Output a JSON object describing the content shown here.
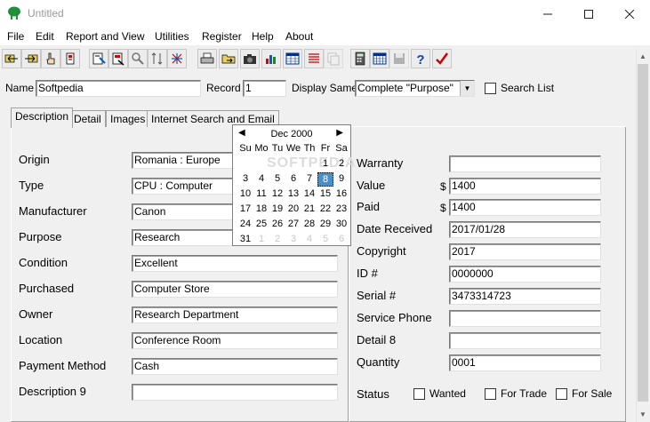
{
  "window": {
    "title": "Untitled"
  },
  "menu": [
    "File",
    "Edit",
    "Report and View",
    "Utilities",
    "Register",
    "Help",
    "About"
  ],
  "search_bar": {
    "name_label": "Name",
    "name_value": "Softpedia",
    "record_label": "Record",
    "record_value": "1",
    "display_label": "Display Same",
    "display_value": "Complete \"Purpose\"",
    "search_list_label": "Search List"
  },
  "tabs": [
    "Description",
    "Detail",
    "Images",
    "Internet Search and Email"
  ],
  "left_fields": [
    {
      "label": "Origin",
      "value": "Romania  : Europe"
    },
    {
      "label": "Type",
      "value": "CPU : Computer"
    },
    {
      "label": "Manufacturer",
      "value": "Canon"
    },
    {
      "label": "Purpose",
      "value": "Research"
    },
    {
      "label": "Condition",
      "value": "Excellent"
    },
    {
      "label": "Purchased",
      "value": "Computer Store"
    },
    {
      "label": "Owner",
      "value": "Research Department"
    },
    {
      "label": "Location",
      "value": "Conference Room"
    },
    {
      "label": "Payment Method",
      "value": "Cash"
    },
    {
      "label": "Description 9",
      "value": ""
    }
  ],
  "right_fields": [
    {
      "label": "Warranty",
      "value": "",
      "prefix": ""
    },
    {
      "label": "Value",
      "value": "1400",
      "prefix": "$"
    },
    {
      "label": "Paid",
      "value": "1400",
      "prefix": "$"
    },
    {
      "label": "Date Received",
      "value": "2017/01/28",
      "prefix": ""
    },
    {
      "label": "Copyright",
      "value": "2017",
      "prefix": ""
    },
    {
      "label": "ID #",
      "value": "0000000",
      "prefix": ""
    },
    {
      "label": "Serial #",
      "value": "3473314723",
      "prefix": ""
    },
    {
      "label": "Service Phone",
      "value": "",
      "prefix": ""
    },
    {
      "label": "Detail 8",
      "value": "",
      "prefix": ""
    },
    {
      "label": "Quantity",
      "value": "0001",
      "prefix": ""
    }
  ],
  "status": {
    "label": "Status",
    "options": [
      "Wanted",
      "For Trade",
      "For Sale"
    ]
  },
  "calendar": {
    "title": "Dec 2000",
    "weekdays": [
      "Su",
      "Mo",
      "Tu",
      "We",
      "Th",
      "Fr",
      "Sa"
    ],
    "weeks": [
      [
        "",
        "",
        "",
        "",
        "",
        "1",
        "2"
      ],
      [
        "3",
        "4",
        "5",
        "6",
        "7",
        "8",
        "9"
      ],
      [
        "10",
        "11",
        "12",
        "13",
        "14",
        "15",
        "16"
      ],
      [
        "17",
        "18",
        "19",
        "20",
        "21",
        "22",
        "23"
      ],
      [
        "24",
        "25",
        "26",
        "27",
        "28",
        "29",
        "30"
      ],
      [
        "31",
        "1",
        "2",
        "3",
        "4",
        "5",
        "6"
      ]
    ],
    "selected": "8",
    "watermark": "SOFTPEDIA"
  },
  "icons": {
    "toolbar": [
      "first-record-icon",
      "next-record-icon",
      "hand-pointer-icon",
      "edit-icon",
      "add-record-icon",
      "delete-record-icon",
      "find-icon",
      "sort-icon",
      "filter-icon",
      "print-icon",
      "open-icon",
      "camera-icon",
      "chart-icon",
      "table-icon",
      "report-icon",
      "duplicate-icon",
      "calculator-icon",
      "calendar-icon",
      "save-icon",
      "help-icon",
      "check-icon"
    ]
  },
  "colors": {
    "selection": "#4a90c8",
    "help": "#1a3fb0",
    "check": "#d00000"
  }
}
